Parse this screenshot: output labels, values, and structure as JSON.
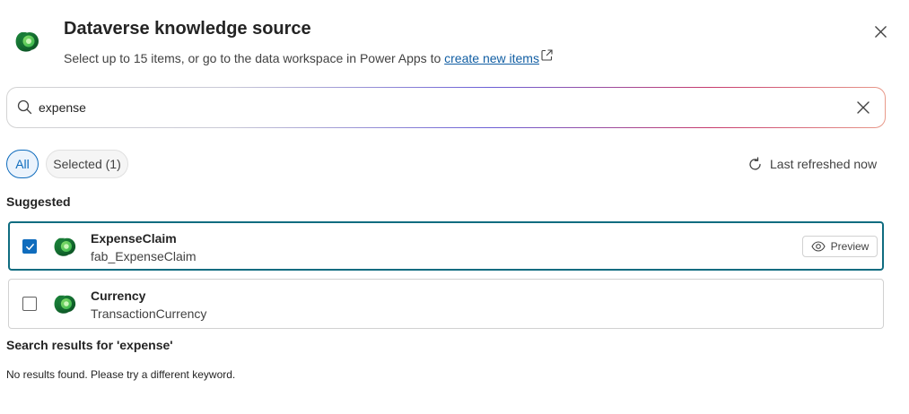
{
  "header": {
    "title": "Dataverse knowledge source",
    "subtitle_prefix": "Select up to 15 items, or go to the data workspace in Power Apps to ",
    "subtitle_link": "create new items"
  },
  "search": {
    "value": "expense",
    "placeholder": ""
  },
  "filters": {
    "all_label": "All",
    "selected_label": "Selected (1)"
  },
  "refresh_label": "Last refreshed now",
  "suggested_label": "Suggested",
  "items": [
    {
      "name": "ExpenseClaim",
      "logical_name": "fab_ExpenseClaim",
      "checked": true
    },
    {
      "name": "Currency",
      "logical_name": "TransactionCurrency",
      "checked": false
    }
  ],
  "preview_label": "Preview",
  "results_label": "Search results for 'expense'",
  "no_results": "No results found. Please try a different keyword.",
  "colors": {
    "accent": "#0f6cbd",
    "selected_border": "#0f6c80",
    "link": "#115ea3",
    "logo_dark": "#0b5a2a",
    "logo_light": "#5fd35f"
  }
}
